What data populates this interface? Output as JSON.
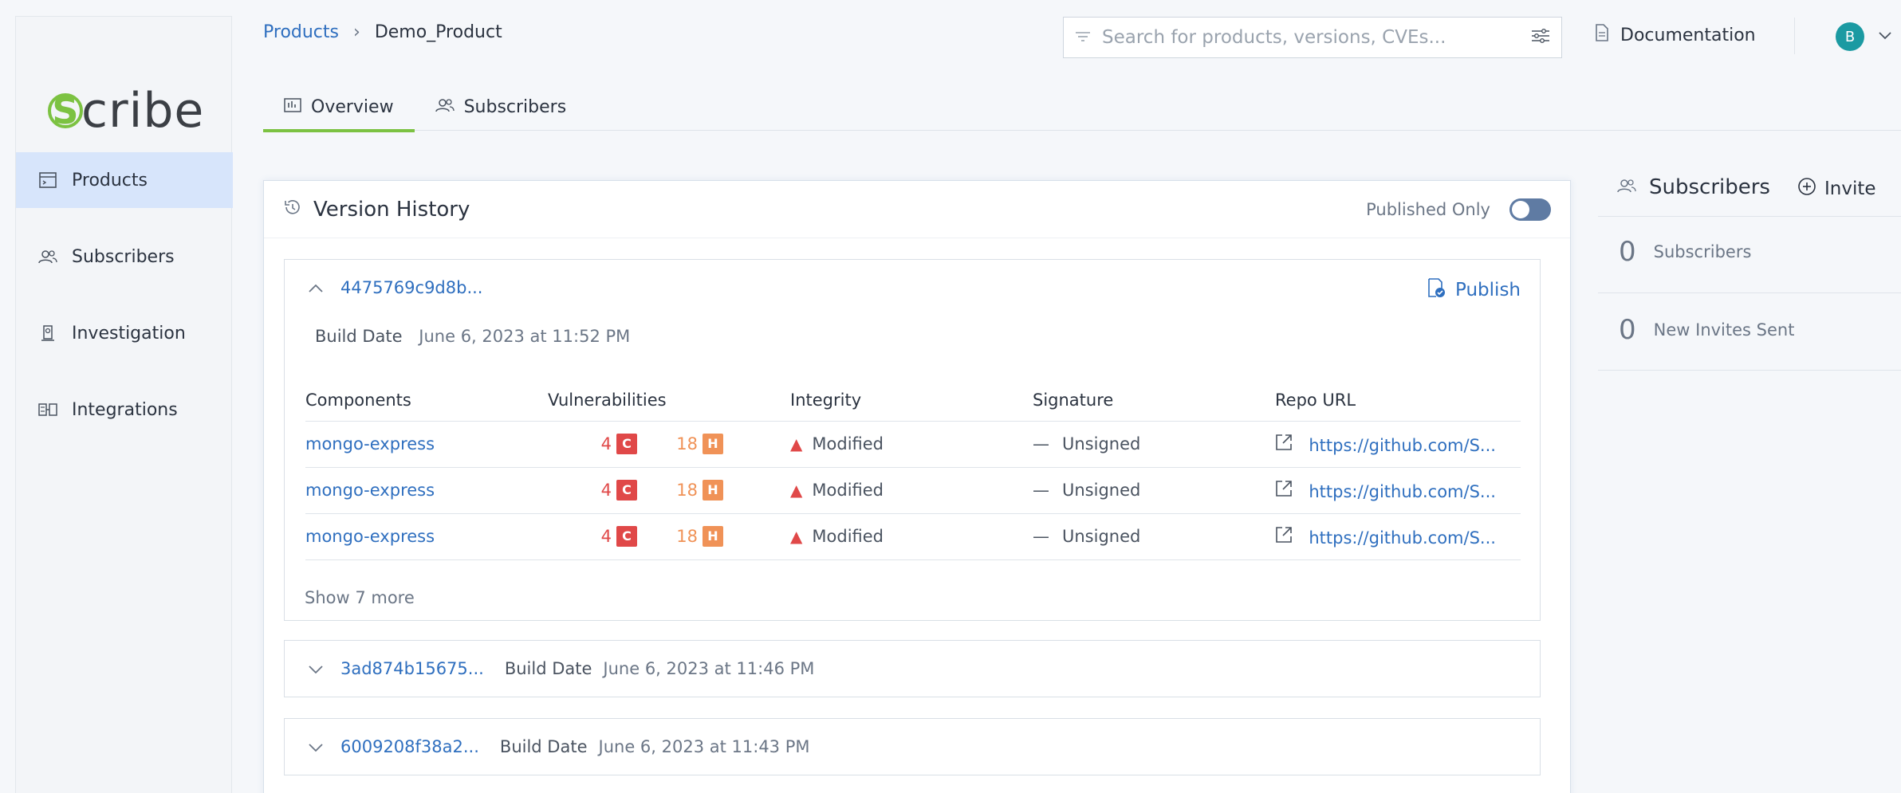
{
  "brand": {
    "logo_letter": "S",
    "logo_rest": "cribe"
  },
  "sidebar": {
    "items": [
      {
        "label": "Products",
        "icon": "products-icon"
      },
      {
        "label": "Subscribers",
        "icon": "subscribers-icon"
      },
      {
        "label": "Investigation",
        "icon": "investigation-icon"
      },
      {
        "label": "Integrations",
        "icon": "integrations-icon"
      }
    ]
  },
  "header": {
    "breadcrumb": {
      "root": "Products",
      "current": "Demo_Product"
    },
    "search_placeholder": "Search for products, versions, CVEs...",
    "documentation": "Documentation",
    "avatar_initial": "B"
  },
  "tabs": [
    {
      "label": "Overview",
      "active": true
    },
    {
      "label": "Subscribers",
      "active": false
    }
  ],
  "version_history": {
    "title": "Version History",
    "published_only_label": "Published Only",
    "published_only": false,
    "columns": [
      "Components",
      "Vulnerabilities",
      "Integrity",
      "Signature",
      "Repo URL"
    ],
    "versions": [
      {
        "hash": "4475769c9d8b...",
        "expanded": true,
        "publish_label": "Publish",
        "build_date_label": "Build Date",
        "build_date": "June 6, 2023 at 11:52 PM",
        "components": [
          {
            "name": "mongo-express",
            "critical": "4",
            "critical_badge": "C",
            "high": "18",
            "high_badge": "H",
            "integrity": "Modified",
            "signature": "Unsigned",
            "repo": "https://github.com/S..."
          },
          {
            "name": "mongo-express",
            "critical": "4",
            "critical_badge": "C",
            "high": "18",
            "high_badge": "H",
            "integrity": "Modified",
            "signature": "Unsigned",
            "repo": "https://github.com/S..."
          },
          {
            "name": "mongo-express",
            "critical": "4",
            "critical_badge": "C",
            "high": "18",
            "high_badge": "H",
            "integrity": "Modified",
            "signature": "Unsigned",
            "repo": "https://github.com/S..."
          }
        ],
        "show_more": "Show 7 more"
      },
      {
        "hash": "3ad874b15675...",
        "expanded": false,
        "build_date_label": "Build Date",
        "build_date": "June 6, 2023 at 11:46 PM"
      },
      {
        "hash": "6009208f38a2...",
        "expanded": false,
        "build_date_label": "Build Date",
        "build_date": "June 6, 2023 at 11:43 PM"
      }
    ]
  },
  "subscribers_panel": {
    "title": "Subscribers",
    "invite_label": "Invite",
    "stats": [
      {
        "value": "0",
        "label": "Subscribers"
      },
      {
        "value": "0",
        "label": "New Invites Sent"
      }
    ]
  },
  "colors": {
    "accent_green": "#7cc242",
    "link_blue": "#2f6fbf",
    "critical_red": "#e04848",
    "high_orange": "#f09257",
    "active_nav_bg": "#d7e5fb"
  }
}
